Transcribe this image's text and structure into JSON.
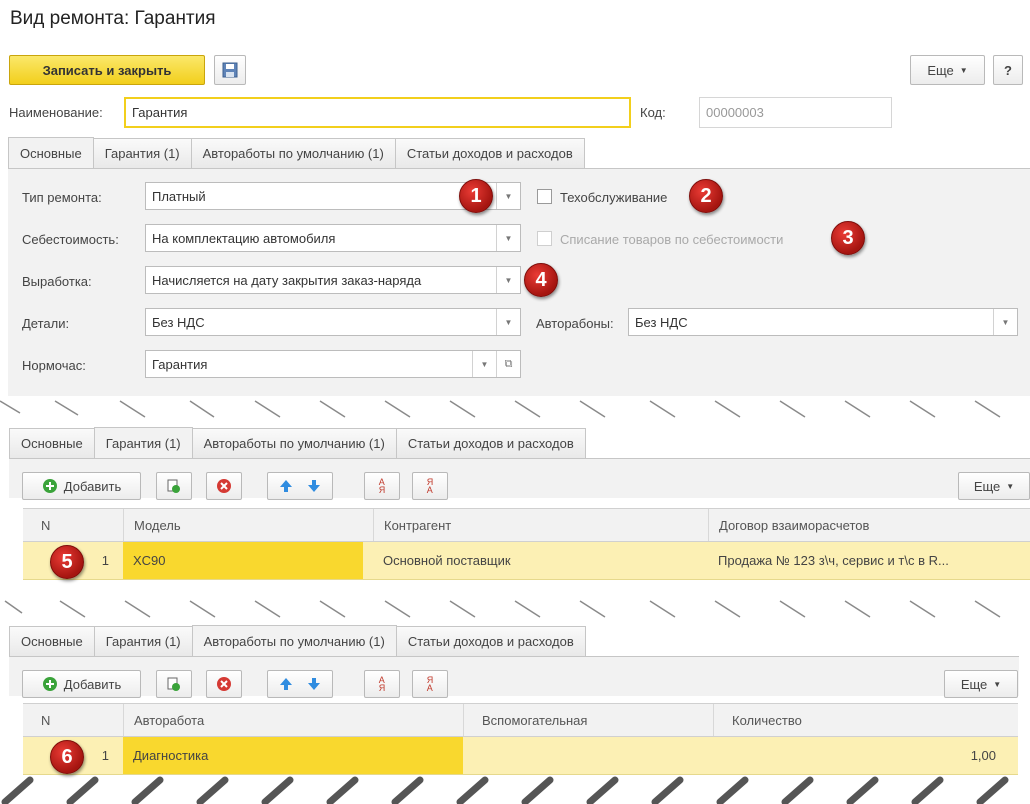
{
  "window": {
    "title": "Вид ремонта: Гарантия"
  },
  "toolbar": {
    "save_close_label": "Записать и закрыть",
    "more_label": "Еще",
    "help_label": "?"
  },
  "header": {
    "name_label": "Наименование:",
    "name_value": "Гарантия",
    "code_label": "Код:",
    "code_value": "00000003"
  },
  "tabs": [
    "Основные",
    "Гарантия (1)",
    "Автоработы по умолчанию (1)",
    "Статьи доходов и расходов"
  ],
  "main": {
    "repair_type_label": "Тип ремонта:",
    "repair_type_value": "Платный",
    "maintenance_label": "Техобслуживание",
    "cost_label": "Себестоимость:",
    "cost_value": "На комплектацию автомобиля",
    "writeoff_label": "Списание товаров по себестоимости",
    "output_label": "Выработка:",
    "output_value": "Начисляется на дату закрытия заказ-наряда",
    "parts_label": "Детали:",
    "parts_value": "Без НДС",
    "autoworks_label": "Авторабоны:",
    "autoworks_value": "Без НДС",
    "normhour_label": "Нормочас:",
    "normhour_value": "Гарантия"
  },
  "warranty": {
    "add_label": "Добавить",
    "more_label": "Еще",
    "columns": [
      "N",
      "Модель",
      "Контрагент",
      "Договор взаиморасчетов"
    ],
    "rows": [
      {
        "n": "1",
        "model": "XC90",
        "counterparty": "Основной поставщик",
        "contract": "Продажа № 123 з\\ч, сервис и т\\с в R..."
      }
    ]
  },
  "default_works": {
    "add_label": "Добавить",
    "more_label": "Еще",
    "columns": [
      "N",
      "Авторабота",
      "Вспомогательная",
      "Количество"
    ],
    "rows": [
      {
        "n": "1",
        "work": "Диагностика",
        "auxiliary": "",
        "quantity": "1,00"
      }
    ]
  },
  "callouts": [
    "1",
    "2",
    "3",
    "4",
    "5",
    "6"
  ],
  "colors": {
    "accent_yellow": "#f2cf1c",
    "row_highlight": "#fcf0b4",
    "selected_cell": "#f9d82e",
    "callout_red": "#c21d17"
  }
}
